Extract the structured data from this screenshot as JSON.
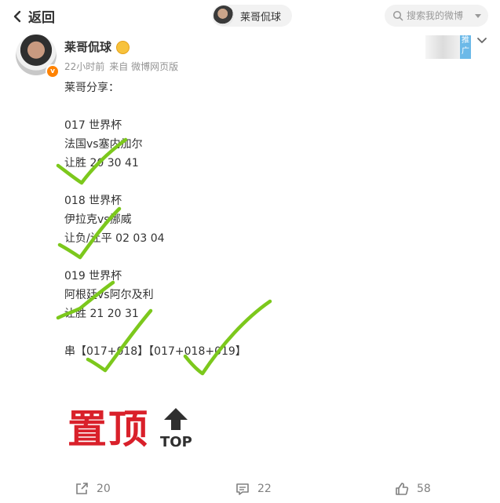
{
  "header": {
    "back_label": "返回",
    "chip_name": "莱哥侃球",
    "search_placeholder": "搜索我的微博"
  },
  "post": {
    "username": "莱哥侃球",
    "time": "22小时前",
    "source": "来自 微博网页版",
    "ad_tag": "推广",
    "lines": [
      "莱哥分享：",
      "",
      "017 世界杯",
      "法国vs塞内加尔",
      "让胜 20 30 41",
      "",
      "018 世界杯",
      "伊拉克vs挪威",
      "让负/让平 02 03 04",
      "",
      "019 世界杯",
      "阿根廷vs阿尔及利",
      "让胜 21 20 31",
      "",
      "串【017+018】【017+018+019】"
    ],
    "pin_text": "置顶",
    "pin_top": "TOP"
  },
  "actions": {
    "repost_count": "20",
    "comment_count": "22",
    "like_count": "58"
  },
  "colors": {
    "check": "#7cc81c",
    "pin_red": "#d9202a",
    "ad_blue": "#6cb9e8",
    "vip_orange": "#ff8200"
  }
}
